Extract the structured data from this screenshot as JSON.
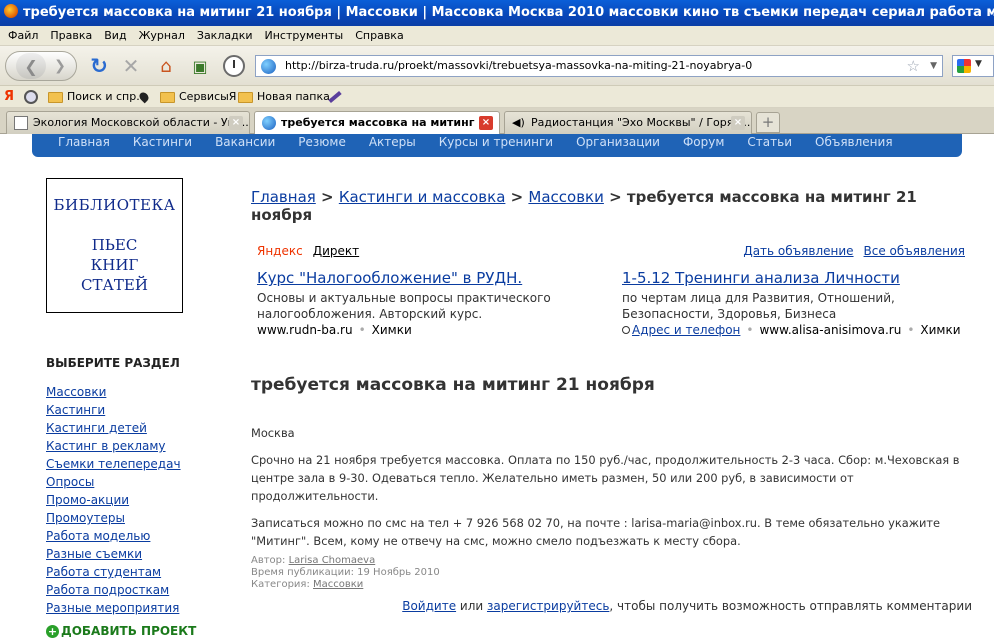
{
  "window": {
    "title": "требуется массовка на митинг 21 ноября | Массовки | Массовка Москва 2010 массовки кино тв съемки передач сериал работа массовка кастинги учас"
  },
  "menu": [
    "Файл",
    "Правка",
    "Вид",
    "Журнал",
    "Закладки",
    "Инструменты",
    "Справка"
  ],
  "toolbar": {
    "url": "http://birza-truda.ru/proekt/massovki/trebuetsya-massovka-na-miting-21-noyabrya-0"
  },
  "bookmarks": [
    {
      "label": "Поиск и спр."
    },
    {
      "label": "СервисыЯ"
    },
    {
      "label": "Новая папка"
    }
  ],
  "tabs": [
    {
      "label": "Экология Московской области - Упр...",
      "active": false
    },
    {
      "label": "требуется массовка на митинг ...",
      "active": true
    },
    {
      "label": "Радиостанция \"Эхо Москвы\" / Горяч...",
      "active": false
    }
  ],
  "sitenav": [
    "Главная",
    "Кастинги",
    "Вакансии",
    "Резюме",
    "Актеры",
    "Курсы и тренинги",
    "Организации",
    "Форум",
    "Статьи",
    "Объявления"
  ],
  "banner": {
    "line1": "БИБЛИОТЕКА",
    "line2": "ПЬЕС",
    "line3": "КНИГ",
    "line4": "СТАТЕЙ"
  },
  "sidebar": {
    "title": "ВЫБЕРИТЕ РАЗДЕЛ",
    "items": [
      "Массовки",
      "Кастинги",
      "Кастинги детей",
      "Кастинг в рекламу",
      "Съемки телепередач",
      "Опросы",
      "Промо-акции",
      "Промоутеры",
      "Работа моделью",
      "Разные съемки",
      "Работа студентам",
      "Работа подросткам",
      "Разные мероприятия"
    ],
    "add_project": "ДОБАВИТЬ ПРОЕКТ"
  },
  "breadcrumb": {
    "home": "Главная",
    "sep": " > ",
    "castings": "Кастинги и массовка",
    "massovki": "Массовки",
    "current": "требуется массовка на митинг 21 ноября"
  },
  "ads": {
    "yandex": "Яндекс",
    "direct": "Директ",
    "give_ad": "Дать объявление",
    "all_ads": "Все объявления",
    "items": [
      {
        "title": "Курс \"Налогообложение\" в РУДН.",
        "text": "Основы и актуальные вопросы практического налогообложения. Авторский курс.",
        "site": "www.rudn-ba.ru",
        "city": "Химки"
      },
      {
        "title": "1-5.12 Тренинги анализа Личности",
        "text": "по чертам лица для Развития, Отношений, Безопасности, Здоровья, Бизнеса",
        "addr": "Адрес и телефон",
        "site": "www.alisa-anisimova.ru",
        "city": "Химки"
      }
    ]
  },
  "article": {
    "title": "требуется массовка на митинг 21 ноября",
    "city": "Москва",
    "p1": "Срочно на 21 ноября требуется массовка. Оплата по 150 руб./час, продолжительность 2-3 часа. Сбор: м.Чеховская в центре зала в 9-30. Одеваться тепло. Желательно иметь размен, 50 или 200 руб, в зависимости от продолжительности.",
    "p2": "Записаться можно по смс на тел + 7 926 568 02 70, на почте : larisa-maria@inbox.ru. В теме обязательно укажите \"Митинг\". Всем, кому не отвечу на смс, можно смело подъезжать к месту сбора.",
    "author_label": "Автор:",
    "author": "Larisa Chomaeva",
    "published_label": "Время публикации:",
    "published": "19 Ноябрь 2010",
    "category_label": "Категория:",
    "category": "Массовки"
  },
  "comments": {
    "login": "Войдите",
    "or": " или ",
    "register": "зарегистрируйтесь",
    "rest": ", чтобы получить возможность отправлять комментарии"
  }
}
